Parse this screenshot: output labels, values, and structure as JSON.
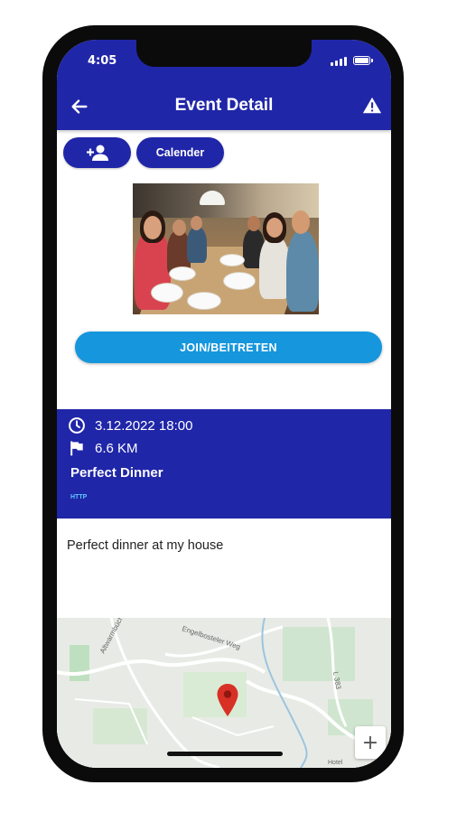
{
  "status_bar": {
    "time": "4:05"
  },
  "app_bar": {
    "title": "Event Detail",
    "back_icon": "arrow-left-icon",
    "action_icon": "warning-icon"
  },
  "actions": {
    "add_person_icon": "person-add-icon",
    "calendar_label": "Calender"
  },
  "join_label": "JOIN/BEITRETEN",
  "event": {
    "datetime": "3.12.2022 18:00",
    "distance": "6.6 KM",
    "title": "Perfect Dinner",
    "link": "HTTP",
    "description": "Perfect dinner at my house"
  },
  "map": {
    "labels": [
      "Altwarmbüchener Weg",
      "Engelbosteler Weg",
      "L 383",
      "Hotel"
    ],
    "zoom_in_label": "+"
  },
  "colors": {
    "primary": "#2026a8",
    "accent": "#1596dd",
    "marker": "#d93025"
  }
}
